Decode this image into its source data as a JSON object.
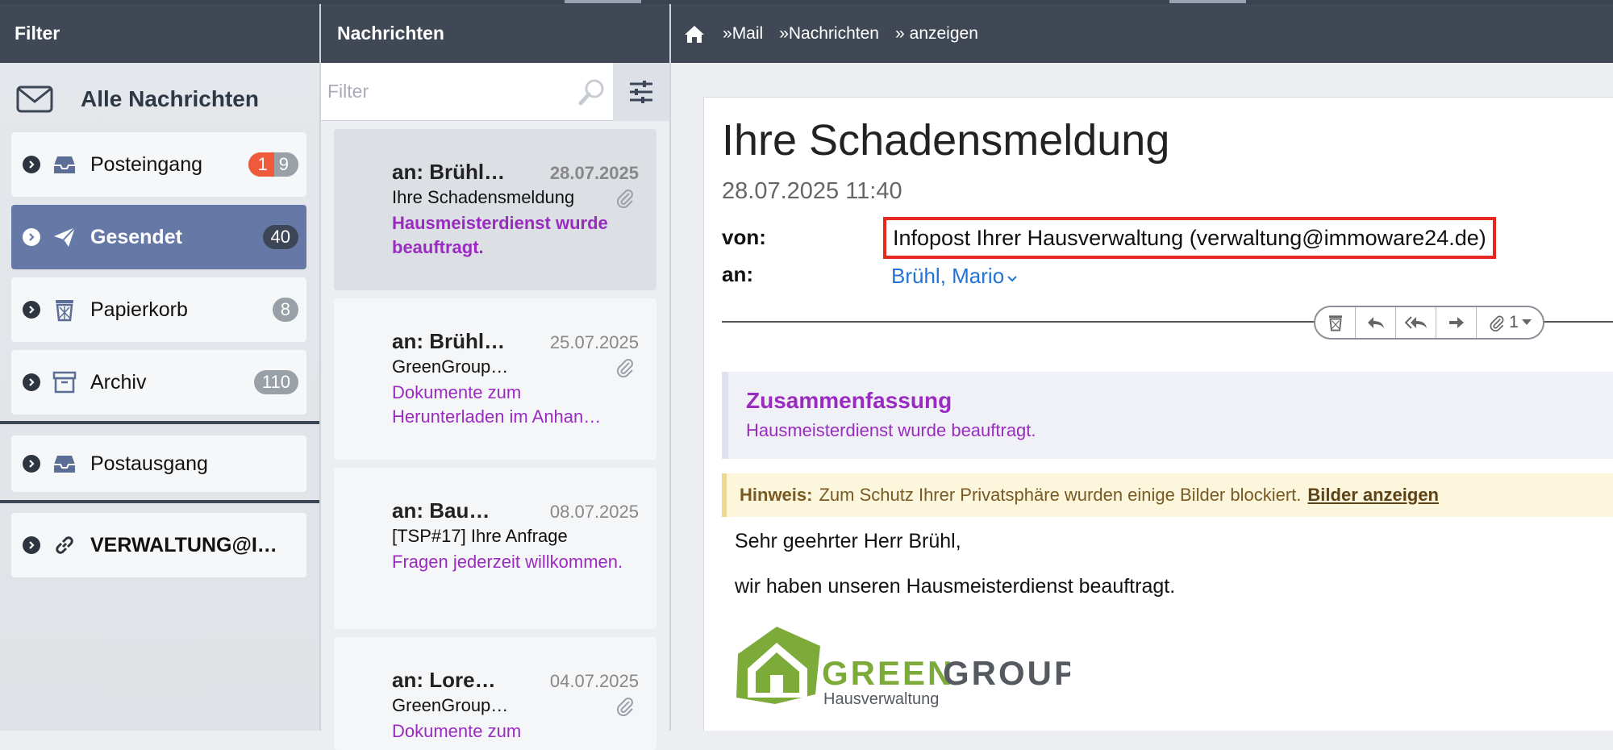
{
  "header": {
    "filter_title": "Filter",
    "messages_title": "Nachrichten",
    "breadcrumb": [
      {
        "sep": "»",
        "label": "Mail"
      },
      {
        "sep": "»",
        "label": "Nachrichten"
      },
      {
        "sep": "»",
        "label": "anzeigen"
      }
    ]
  },
  "sidebar": {
    "all_messages": "Alle Nachrichten",
    "folders": [
      {
        "name": "Posteingang",
        "badge_unread": "1",
        "badge_total": "9"
      },
      {
        "name": "Gesendet",
        "badge": "40"
      },
      {
        "name": "Papierkorb",
        "badge": "8"
      },
      {
        "name": "Archiv",
        "badge": "110"
      },
      {
        "name": "Postausgang"
      },
      {
        "name": "VERWALTUNG@I…"
      }
    ]
  },
  "list": {
    "filter_placeholder": "Filter",
    "messages": [
      {
        "to": "an: Brühl…",
        "date": "28.07.2025",
        "subject": "Ihre Schadensmeldung",
        "preview": "Hausmeisterdienst wurde beauftragt."
      },
      {
        "to": "an: Brühl…",
        "date": "25.07.2025",
        "subject": "GreenGroup…",
        "preview": "Dokumente zum Herunterladen im Anhan…"
      },
      {
        "to": "an: Bau…",
        "date": "08.07.2025",
        "subject": "[TSP#17] Ihre Anfrage",
        "preview": "Fragen jederzeit willkommen."
      },
      {
        "to": "an: Lore…",
        "date": "04.07.2025",
        "subject": "GreenGroup…",
        "preview": "Dokumente zum"
      }
    ]
  },
  "message": {
    "subject": "Ihre Schadensmeldung",
    "datetime": "28.07.2025 11:40",
    "from_label": "von:",
    "from_value": "Infopost Ihrer Hausverwaltung (verwaltung@immoware24.de)",
    "to_label": "an:",
    "to_value": "Brühl, Mario",
    "attachment_count": "1",
    "summary_title": "Zusammenfassung",
    "summary_text": "Hausmeisterdienst wurde beauftragt.",
    "notice_label": "Hinweis:",
    "notice_text": "Zum Schutz Ihrer Privatsphäre wurden einige Bilder blockiert.",
    "notice_link": "Bilder anzeigen",
    "greeting": "Sehr geehrter Herr Brühl,",
    "body_line": "wir haben unseren Hausmeisterdienst beauftragt.",
    "logo_green": "GREEN",
    "logo_group": "GROUP",
    "logo_sub": "Hausverwaltung"
  },
  "colors": {
    "header_bg": "#414855",
    "active_folder": "#6679a6",
    "preview_purple": "#9a2bc0",
    "link_blue": "#2273d6",
    "highlight_red": "#e8281e",
    "logo_green": "#7cab3a",
    "logo_gray": "#555a60"
  }
}
